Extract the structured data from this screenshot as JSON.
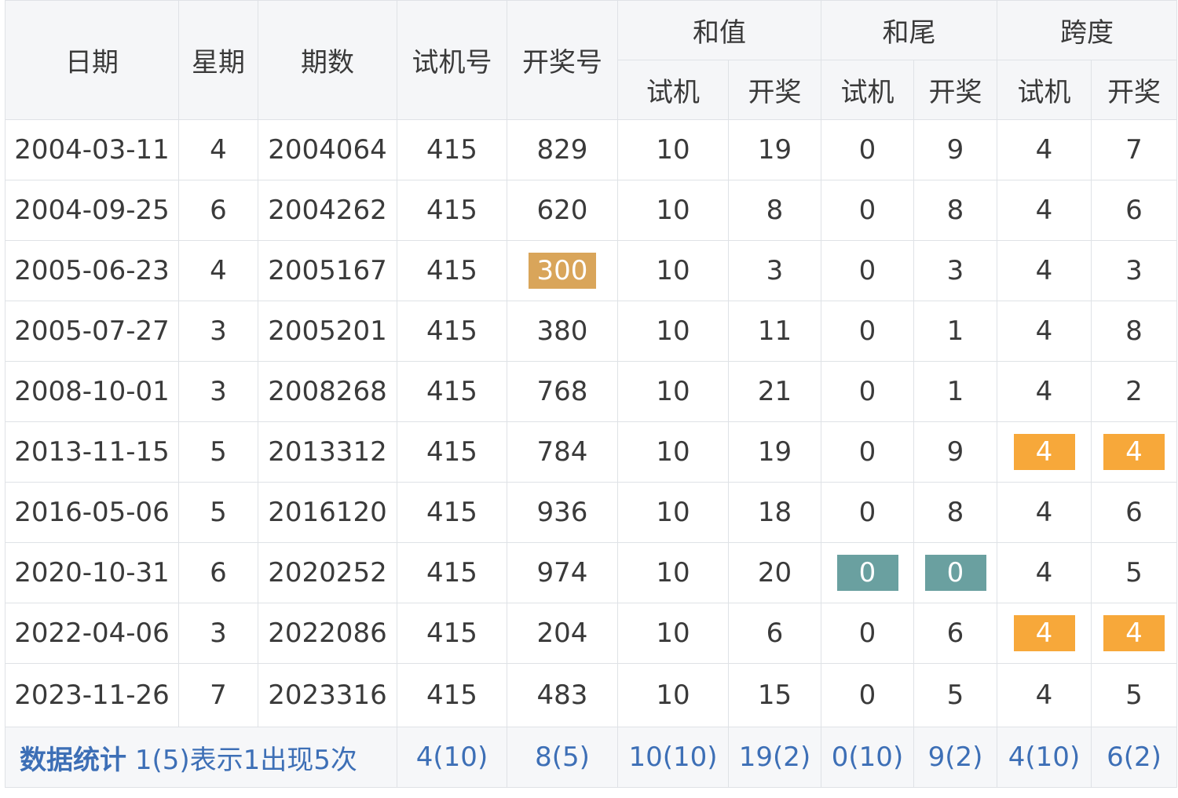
{
  "header": {
    "date": "日期",
    "weekday": "星期",
    "issue": "期数",
    "trial_no": "试机号",
    "draw_no": "开奖号",
    "sum_group": "和值",
    "tail_group": "和尾",
    "span_group": "跨度",
    "trial": "试机",
    "draw": "开奖"
  },
  "rows": [
    {
      "date": "2004-03-11",
      "weekday": "4",
      "issue": "2004064",
      "trial": "415",
      "draw": "829",
      "sum_trial": "10",
      "sum_draw": "19",
      "tail_trial": "0",
      "tail_draw": "9",
      "span_trial": "4",
      "span_draw": "7"
    },
    {
      "date": "2004-09-25",
      "weekday": "6",
      "issue": "2004262",
      "trial": "415",
      "draw": "620",
      "sum_trial": "10",
      "sum_draw": "8",
      "tail_trial": "0",
      "tail_draw": "8",
      "span_trial": "4",
      "span_draw": "6"
    },
    {
      "date": "2005-06-23",
      "weekday": "4",
      "issue": "2005167",
      "trial": "415",
      "draw": "300",
      "sum_trial": "10",
      "sum_draw": "3",
      "tail_trial": "0",
      "tail_draw": "3",
      "span_trial": "4",
      "span_draw": "3"
    },
    {
      "date": "2005-07-27",
      "weekday": "3",
      "issue": "2005201",
      "trial": "415",
      "draw": "380",
      "sum_trial": "10",
      "sum_draw": "11",
      "tail_trial": "0",
      "tail_draw": "1",
      "span_trial": "4",
      "span_draw": "8"
    },
    {
      "date": "2008-10-01",
      "weekday": "3",
      "issue": "2008268",
      "trial": "415",
      "draw": "768",
      "sum_trial": "10",
      "sum_draw": "21",
      "tail_trial": "0",
      "tail_draw": "1",
      "span_trial": "4",
      "span_draw": "2"
    },
    {
      "date": "2013-11-15",
      "weekday": "5",
      "issue": "2013312",
      "trial": "415",
      "draw": "784",
      "sum_trial": "10",
      "sum_draw": "19",
      "tail_trial": "0",
      "tail_draw": "9",
      "span_trial": "4",
      "span_draw": "4"
    },
    {
      "date": "2016-05-06",
      "weekday": "5",
      "issue": "2016120",
      "trial": "415",
      "draw": "936",
      "sum_trial": "10",
      "sum_draw": "18",
      "tail_trial": "0",
      "tail_draw": "8",
      "span_trial": "4",
      "span_draw": "6"
    },
    {
      "date": "2020-10-31",
      "weekday": "6",
      "issue": "2020252",
      "trial": "415",
      "draw": "974",
      "sum_trial": "10",
      "sum_draw": "20",
      "tail_trial": "0",
      "tail_draw": "0",
      "span_trial": "4",
      "span_draw": "5"
    },
    {
      "date": "2022-04-06",
      "weekday": "3",
      "issue": "2022086",
      "trial": "415",
      "draw": "204",
      "sum_trial": "10",
      "sum_draw": "6",
      "tail_trial": "0",
      "tail_draw": "6",
      "span_trial": "4",
      "span_draw": "4"
    },
    {
      "date": "2023-11-26",
      "weekday": "7",
      "issue": "2023316",
      "trial": "415",
      "draw": "483",
      "sum_trial": "10",
      "sum_draw": "15",
      "tail_trial": "0",
      "tail_draw": "5",
      "span_trial": "4",
      "span_draw": "5"
    }
  ],
  "summary": {
    "title": "数据统计",
    "note": "1(5)表示1出现5次",
    "trial": "4(10)",
    "draw": "8(5)",
    "sum_trial": "10(10)",
    "sum_draw": "19(2)",
    "tail_trial": "0(10)",
    "tail_draw": "9(2)",
    "span_trial": "4(10)",
    "span_draw": "6(2)"
  },
  "colors": {
    "draw_text": "#c0392b",
    "highlight_tan": "#d9a55a",
    "highlight_orange": "#f7a83a",
    "highlight_teal": "#6aa0a0",
    "summary_text": "#3d6fb6"
  }
}
